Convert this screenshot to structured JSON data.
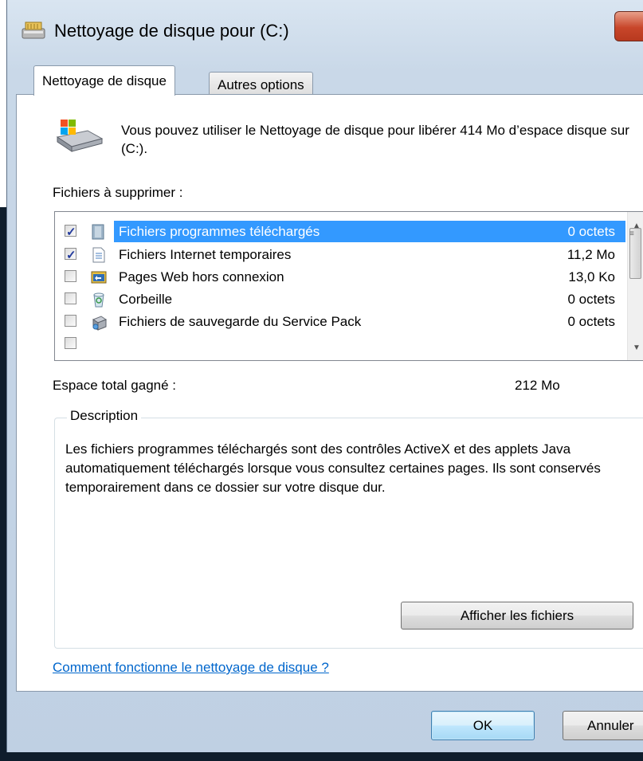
{
  "window": {
    "title": "Nettoyage de disque pour  (C:)"
  },
  "tabs": [
    {
      "label": "Nettoyage de disque",
      "active": true
    },
    {
      "label": "Autres options",
      "active": false
    }
  ],
  "intro": {
    "text": "Vous pouvez utiliser le Nettoyage de disque pour libérer 414 Mo d’espace disque sur  (C:)."
  },
  "files": {
    "label": "Fichiers à supprimer :",
    "items": [
      {
        "name": "Fichiers programmes téléchargés",
        "size": "0 octets",
        "checked": true,
        "selected": true,
        "icon": "folder-icon"
      },
      {
        "name": "Fichiers Internet temporaires",
        "size": "11,2 Mo",
        "checked": true,
        "selected": false,
        "icon": "document-icon"
      },
      {
        "name": "Pages Web hors connexion",
        "size": "13,0 Ko",
        "checked": false,
        "selected": false,
        "icon": "offline-pages-icon"
      },
      {
        "name": "Corbeille",
        "size": "0 octets",
        "checked": false,
        "selected": false,
        "icon": "recycle-bin-icon"
      },
      {
        "name": "Fichiers de sauvegarde du Service Pack",
        "size": "0 octets",
        "checked": false,
        "selected": false,
        "icon": "service-pack-icon"
      }
    ]
  },
  "space": {
    "label": "Espace total gagné :",
    "value": "212 Mo"
  },
  "description": {
    "title": "Description",
    "text": "Les fichiers programmes téléchargés sont des contrôles ActiveX et des applets Java automatiquement téléchargés lorsque vous consultez certaines pages. Ils sont conservés temporairement dans ce dossier sur votre disque dur.",
    "button_label": "Afficher les fichiers"
  },
  "help_link": "Comment fonctionne le nettoyage de disque ?",
  "buttons": {
    "ok": "OK",
    "cancel": "Annuler"
  },
  "colors": {
    "selection": "#3399ff",
    "link": "#0066cc",
    "accent": "#3c7fb1"
  }
}
